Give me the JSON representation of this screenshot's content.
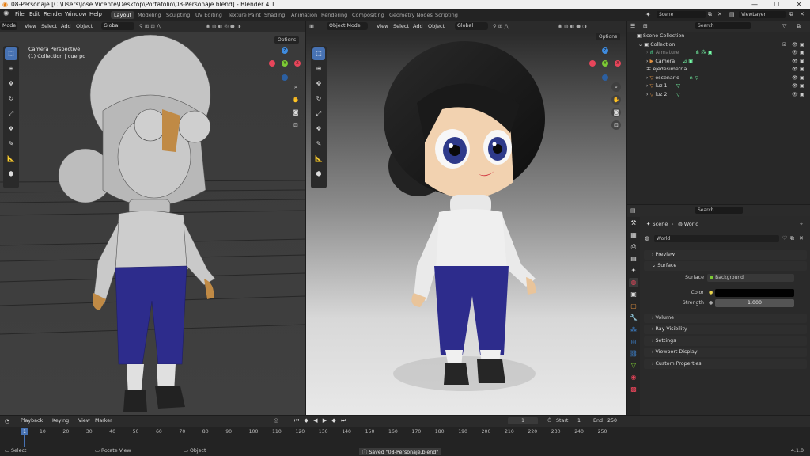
{
  "title": "08-Personaje [C:\\Users\\Jose Vicente\\Desktop\\Portafolio\\08-Personaje.blend] - Blender 4.1",
  "menu": [
    "File",
    "Edit",
    "Render",
    "Window",
    "Help"
  ],
  "workspaces": [
    "Layout",
    "Modeling",
    "Sculpting",
    "UV Editing",
    "Texture Paint",
    "Shading",
    "Animation",
    "Rendering",
    "Compositing",
    "Geometry Nodes",
    "Scripting"
  ],
  "scene_field": "Scene",
  "viewlayer_field": "ViewLayer",
  "left_vp": {
    "mode": "Mode",
    "menus": [
      "View",
      "Select",
      "Add",
      "Object"
    ],
    "orientation": "Global",
    "options": "Options",
    "overlay_title": "Camera Perspective",
    "overlay_sub": "(1) Collection | cuerpo"
  },
  "right_vp": {
    "mode": "Object Mode",
    "menus": [
      "View",
      "Select",
      "Add",
      "Object"
    ],
    "orientation": "Global",
    "options": "Options"
  },
  "gizmo": {
    "x": "X",
    "y": "Y",
    "z": "Z"
  },
  "outliner": {
    "search_placeholder": "Search",
    "root": "Scene Collection",
    "items": [
      {
        "name": "Collection",
        "depth": 0
      },
      {
        "name": "Armature",
        "depth": 1
      },
      {
        "name": "Camera",
        "depth": 1
      },
      {
        "name": "ejedesimetria",
        "depth": 1
      },
      {
        "name": "escenario",
        "depth": 1
      },
      {
        "name": "luz 1",
        "depth": 1
      },
      {
        "name": "luz 2",
        "depth": 1
      }
    ]
  },
  "properties": {
    "search_placeholder": "Search",
    "breadcrumb_scene": "Scene",
    "breadcrumb_world": "World",
    "world_field": "World",
    "panels": {
      "preview": "Preview",
      "surface": "Surface",
      "volume": "Volume",
      "ray_visibility": "Ray Visibility",
      "settings": "Settings",
      "viewport_display": "Viewport Display",
      "custom_properties": "Custom Properties"
    },
    "surface_label": "Surface",
    "surface_value": "Background",
    "color_label": "Color",
    "strength_label": "Strength",
    "strength_value": "1.000"
  },
  "timeline": {
    "menus": [
      "Playback",
      "Keying",
      "View",
      "Marker"
    ],
    "current_frame": "1",
    "start_label": "Start",
    "start_value": "1",
    "end_label": "End",
    "end_value": "250",
    "ticks": [
      "10",
      "20",
      "30",
      "40",
      "50",
      "60",
      "70",
      "80",
      "90",
      "100",
      "110",
      "120",
      "130",
      "140",
      "150",
      "160",
      "170",
      "180",
      "190",
      "200",
      "210",
      "220",
      "230",
      "240",
      "250"
    ],
    "playhead": "1"
  },
  "status": {
    "select": "Select",
    "rotate": "Rotate View",
    "object": "Object",
    "saved": "Saved \"08-Personaje.blend\"",
    "version": "4.1.0"
  },
  "colors": {
    "accent": "#4772b3",
    "gizmo_x": "#e8455a",
    "gizmo_y": "#7cc935",
    "gizmo_z": "#3f8ce0",
    "pants": "#2d2c8c",
    "skin": "#f2d2b0"
  }
}
